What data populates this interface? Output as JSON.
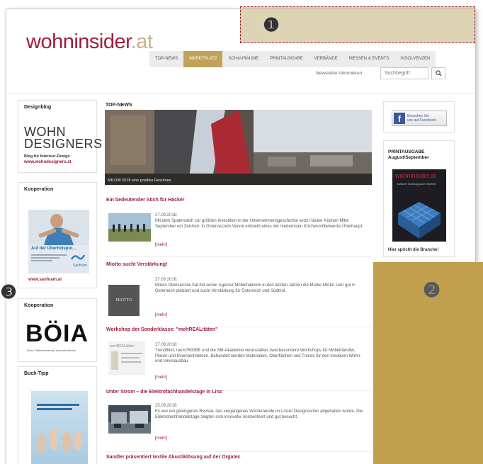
{
  "header": {
    "logo_main": "wohninsider",
    "logo_suffix": ".at",
    "nav": [
      {
        "label": "TOP-NEWS"
      },
      {
        "label": "MARKTPLATZ"
      },
      {
        "label": "SCHAURÄUME"
      },
      {
        "label": "PRINTAUSGABE"
      },
      {
        "label": "VERBÄNDE"
      },
      {
        "label": "MESSEN & EVENTS"
      },
      {
        "label": "INSOLVENZEN"
      }
    ],
    "newsletter": "Newsletter Abonnieren",
    "search_placeholder": "Suchbegriff"
  },
  "left": {
    "designblog": {
      "title": "Designblog",
      "logo_line1": "WOHN",
      "logo_line2": "DESIGNERS",
      "tagline": "Blog für Interieur-Design",
      "link": "www.wohndesigners.at"
    },
    "koop1": {
      "title": "Kooperation",
      "ad_text": "Auf der Überholspur...",
      "brand": "Sanfoam",
      "link": "www.sanfoam.at"
    },
    "koop2": {
      "title": "Kooperation",
      "logo": "BÖIA",
      "subtitle": "Bund Österreichischer Innenarchitektur"
    },
    "buchtipp": {
      "title": "Buch-Tipp"
    }
  },
  "main": {
    "section_title": "TOP-NEWS",
    "hero_caption": "MILOW 2018 eine positive Resümee",
    "articles": [
      {
        "title": "Ein bedeutender Stich für Häcker",
        "date": "27.09.2018:",
        "body": "Mit dem Spatenstich zur größten Investition in der Unternehmensgeschichte setzt Häcker Küchen Mitte September ein Zeichen. In Ostervezzeln Venne entsteht eines der modernsten Küchenmöbelwerks Überhaupt.",
        "more": "[mehr]"
      },
      {
        "title": "Miotto sucht Verstärkung!",
        "date": "27.09.2018:",
        "thumb_label": "MIOTTO",
        "body": "Motan Obersierske hat mit seiner Agentur Möbelnativem in den letzten Jahren die Marke Miotto sehr gut in Österreich platziert und sucht Verstärkung für Österreich und Südtirol.",
        "more": "[mehr]"
      },
      {
        "title": "Workshop der Sonderklasse: \"mehREALitäten\"",
        "date": "27.09.2018:",
        "thumb_label": "mehREALitäten",
        "body": "Trendfilter, raum7MOBE und die SM-Akademie veranstalten zwei besondere Workshops für Möbelhändler, Planer und Innenarchitekten. Behandelt werden Materialien, Oberflächen und Trends für den kreativen Wohn- und Innenausbau.",
        "more": "[mehr]"
      },
      {
        "title": "Unter Strom – die Elektrofachhandelstage in Linz",
        "date": "25.09.2018:",
        "body": "Es war ein gelungenes Revival, das vergangenes Wochenende im Linzer Designcenter abgehalten wurde. Die Elektrofachhandelstage zeigten sich innovativ, konzentriert und gut besucht.",
        "more": "[mehr]"
      },
      {
        "title": "Sandler präsentiert textile Akustiklösung auf der Orgatec"
      }
    ]
  },
  "right": {
    "facebook": {
      "line1": "Besuchen Sie",
      "line2": "uns auf Facebook!"
    },
    "print": {
      "title_line1": "PRINTAUSGABE",
      "title_line2": "August/September",
      "cover_logo": "wohninsider.at",
      "cover_text": "Schöner Sonntag sucht Sieben",
      "caption": "Hier spricht die Branche!"
    }
  },
  "callouts": {
    "one": "❶",
    "two": "❷",
    "three": "❸"
  },
  "colors": {
    "brand": "#9e1d3b",
    "gold": "#c0a04f",
    "nav_active": "#c1a25b"
  }
}
